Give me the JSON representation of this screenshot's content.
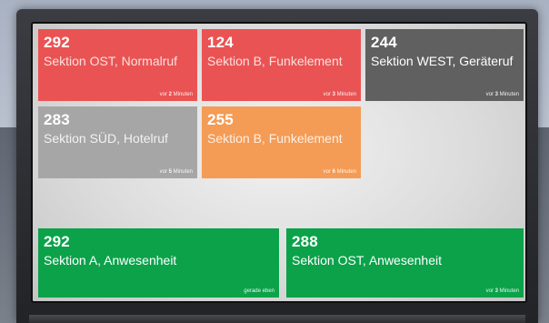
{
  "tiles": [
    {
      "number": "292",
      "location": "Sektion OST, Normalruf",
      "time_prefix": "vor",
      "time_value": "2",
      "time_unit": "Minuten"
    },
    {
      "number": "124",
      "location": "Sektion B, Funkelement",
      "time_prefix": "vor",
      "time_value": "3",
      "time_unit": "Minuten"
    },
    {
      "number": "244",
      "location": "Sektion WEST, Geräteruf",
      "time_prefix": "vor",
      "time_value": "3",
      "time_unit": "Minuten"
    },
    {
      "number": "283",
      "location": "Sektion SÜD, Hotelruf",
      "time_prefix": "vor",
      "time_value": "5",
      "time_unit": "Minuten"
    },
    {
      "number": "255",
      "location": "Sektion B, Funkelement",
      "time_prefix": "vor",
      "time_value": "6",
      "time_unit": "Minuten"
    },
    {
      "number": "292",
      "location": "Sektion A, Anwesenheit",
      "time_prefix": "",
      "time_value": "",
      "time_unit": "gerade eben"
    },
    {
      "number": "288",
      "location": "Sektion OST, Anwesenheit",
      "time_prefix": "vor",
      "time_value": "3",
      "time_unit": "Minuten"
    }
  ],
  "colors": {
    "red": "#ea5353",
    "dark_grey": "#606060",
    "grey": "#a6a6a6",
    "orange": "#f49b55",
    "green": "#0ba24a"
  }
}
